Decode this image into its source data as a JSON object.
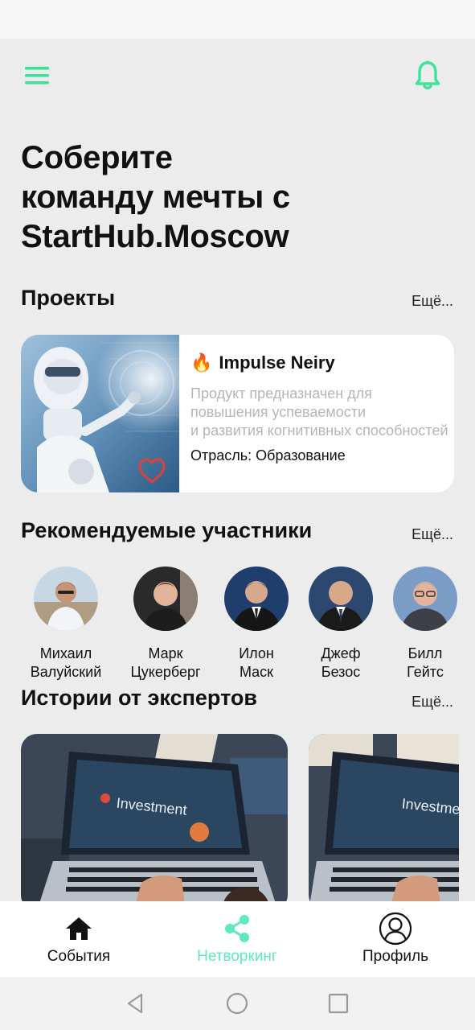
{
  "header": {
    "menu_icon": "hamburger-icon",
    "notification_icon": "bell-icon",
    "accent": "#3ee39a"
  },
  "hero": {
    "line1": "Соберите",
    "line2": "команду мечты с",
    "line3": "StartHub.Moscow"
  },
  "projects": {
    "title": "Проекты",
    "more": "Ещё...",
    "card": {
      "emoji": "🔥",
      "name": "Impulse Neiry",
      "desc_line1": "Продукт предназначен для",
      "desc_line2": "повышения успеваемости",
      "desc_line3": "и развития когнитивных способностей",
      "industry": "Отрасль: Образование"
    }
  },
  "members": {
    "title": "Рекомендуемые участники",
    "more": "Ещё...",
    "items": [
      {
        "first": "Михаил",
        "last": "Валуйский"
      },
      {
        "first": "Марк",
        "last": "Цукерберг"
      },
      {
        "first": "Илон",
        "last": "Маск"
      },
      {
        "first": "Джеф",
        "last": "Безос"
      },
      {
        "first": "Билл",
        "last": "Гейтс"
      }
    ]
  },
  "stories": {
    "title": "Истории от экспертов",
    "more": "Ещё...",
    "card_text": "Investment"
  },
  "bottom_nav": {
    "events": "События",
    "networking": "Нетворкинг",
    "profile": "Профиль",
    "active_color": "#5fe8c1"
  }
}
